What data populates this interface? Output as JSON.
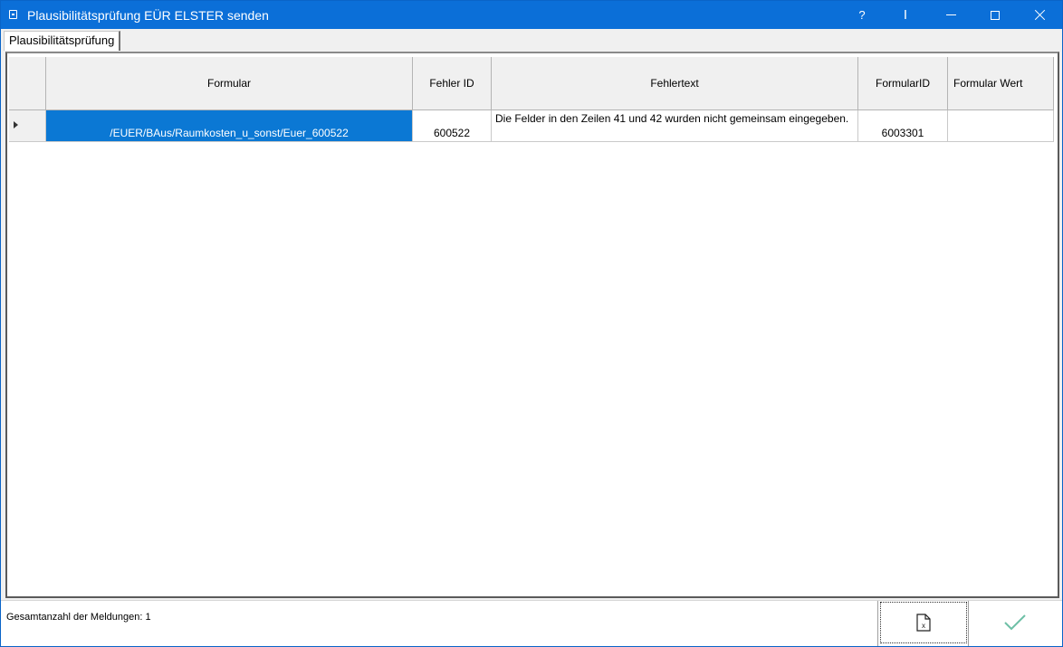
{
  "window": {
    "title": "Plausibilitätsprüfung EÜR ELSTER senden",
    "help_label": "?",
    "cursor_label": "I",
    "accent_color": "#0b6fd8"
  },
  "tabs": [
    {
      "label": "Plausibilitätsprüfung",
      "selected": true
    }
  ],
  "grid": {
    "columns": [
      "Formular",
      "Fehler ID",
      "Fehlertext",
      "FormularID",
      "Formular Wert"
    ],
    "rows": [
      {
        "formular": "/EUER/BAus/Raumkosten_u_sonst/Euer_600522",
        "fehler_id": "600522",
        "fehlertext": "Die Felder in den Zeilen 41 und 42 wurden nicht gemeinsam eingegeben.",
        "formular_id": "6003301",
        "formular_wert": "",
        "selected": true
      }
    ],
    "selection_color": "#0b78d4"
  },
  "status": {
    "total_label": "Gesamtanzahl der Meldungen: 1"
  },
  "buttons": {
    "export_icon": "excel-export-icon",
    "ok_icon": "checkmark-icon"
  }
}
